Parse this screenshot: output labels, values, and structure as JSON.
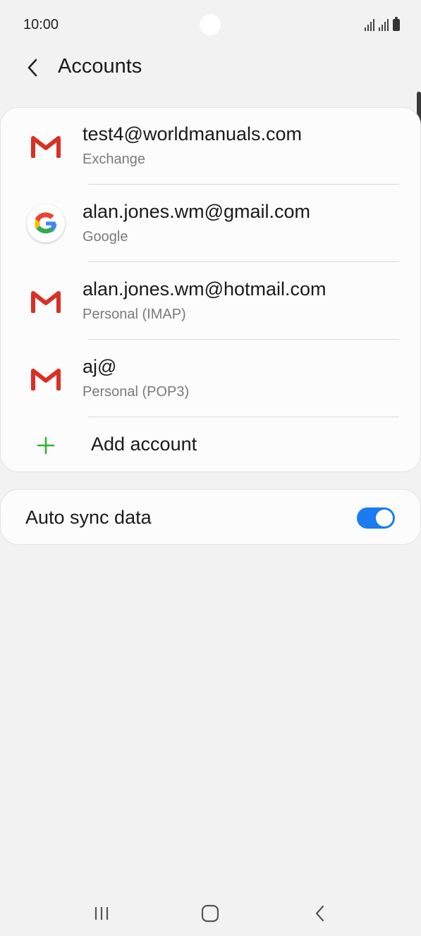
{
  "status_bar": {
    "time": "10:00"
  },
  "header": {
    "title": "Accounts"
  },
  "accounts": [
    {
      "email": "test4@worldmanuals.com",
      "type": "Exchange",
      "icon": "gmail-icon"
    },
    {
      "email": "alan.jones.wm@gmail.com",
      "type": "Google",
      "icon": "google-icon"
    },
    {
      "email": "alan.jones.wm@hotmail.com",
      "type": "Personal (IMAP)",
      "icon": "gmail-icon"
    },
    {
      "email": "aj@",
      "type": "Personal (POP3)",
      "icon": "gmail-icon"
    }
  ],
  "add_account": {
    "label": "Add account"
  },
  "auto_sync": {
    "label": "Auto sync data",
    "enabled": true
  },
  "colors": {
    "accent": "#1a7cf0",
    "add_green": "#2fb32f",
    "gmail_red": "#d93025"
  }
}
